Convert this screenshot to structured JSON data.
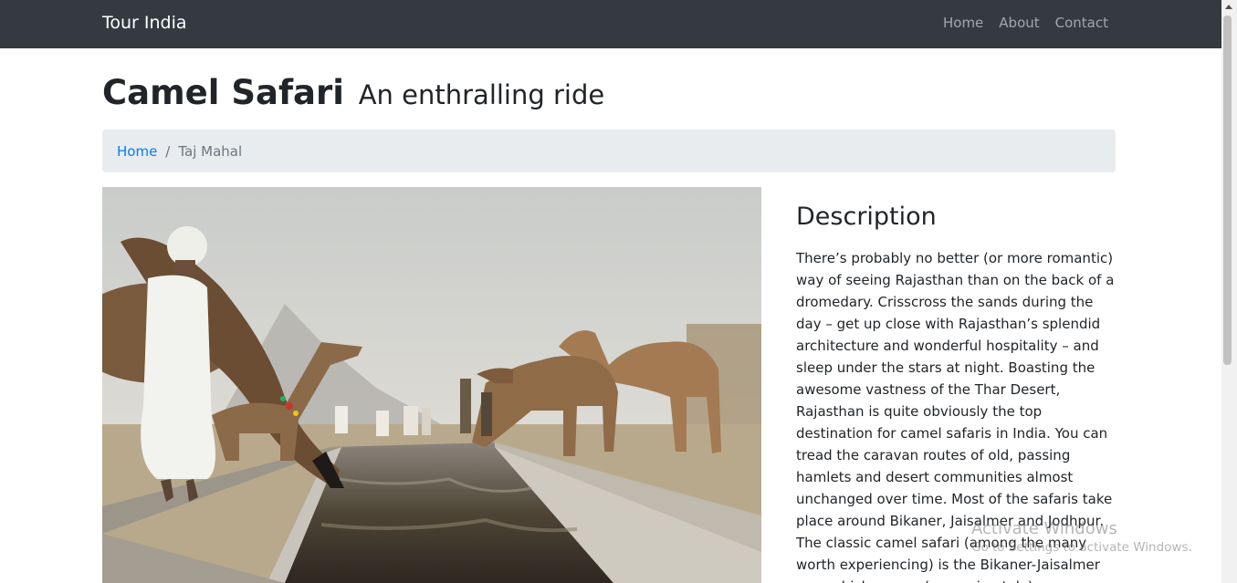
{
  "navbar": {
    "brand": "Tour India",
    "links": [
      "Home",
      "About",
      "Contact"
    ]
  },
  "header": {
    "title": "Camel Safari",
    "subtitle": "An enthralling ride"
  },
  "breadcrumb": {
    "home": "Home",
    "separator": "/",
    "current": "Taj Mahal"
  },
  "photo": {
    "subject": "camels drinking at a water channel with herders in white turbans"
  },
  "description": {
    "heading": "Description",
    "text": "There’s probably no better (or more romantic) way of seeing Rajasthan than on the back of a dromedary. Crisscross the sands during the day – get up close with Rajasthan’s splendid architecture and wonderful hospitality – and sleep under the stars at night. Boasting the awesome vastness of the Thar Desert, Rajasthan is quite obviously the top destination for camel safaris in India. You can tread the caravan routes of old, passing hamlets and desert communities almost unchanged over time. Most of the safaris take place around Bikaner, Jaisalmer and Jodhpur. The classic camel safari (among the many worth experiencing) is the Bikaner-Jaisalmer one, which covers (approximately)"
  },
  "watermark": {
    "title": "Activate Windows",
    "subtitle": "Go to Settings to activate Windows."
  },
  "colors": {
    "navbar_bg": "#343a40",
    "link": "#007bff",
    "breadcrumb_bg": "#e9ecef"
  }
}
